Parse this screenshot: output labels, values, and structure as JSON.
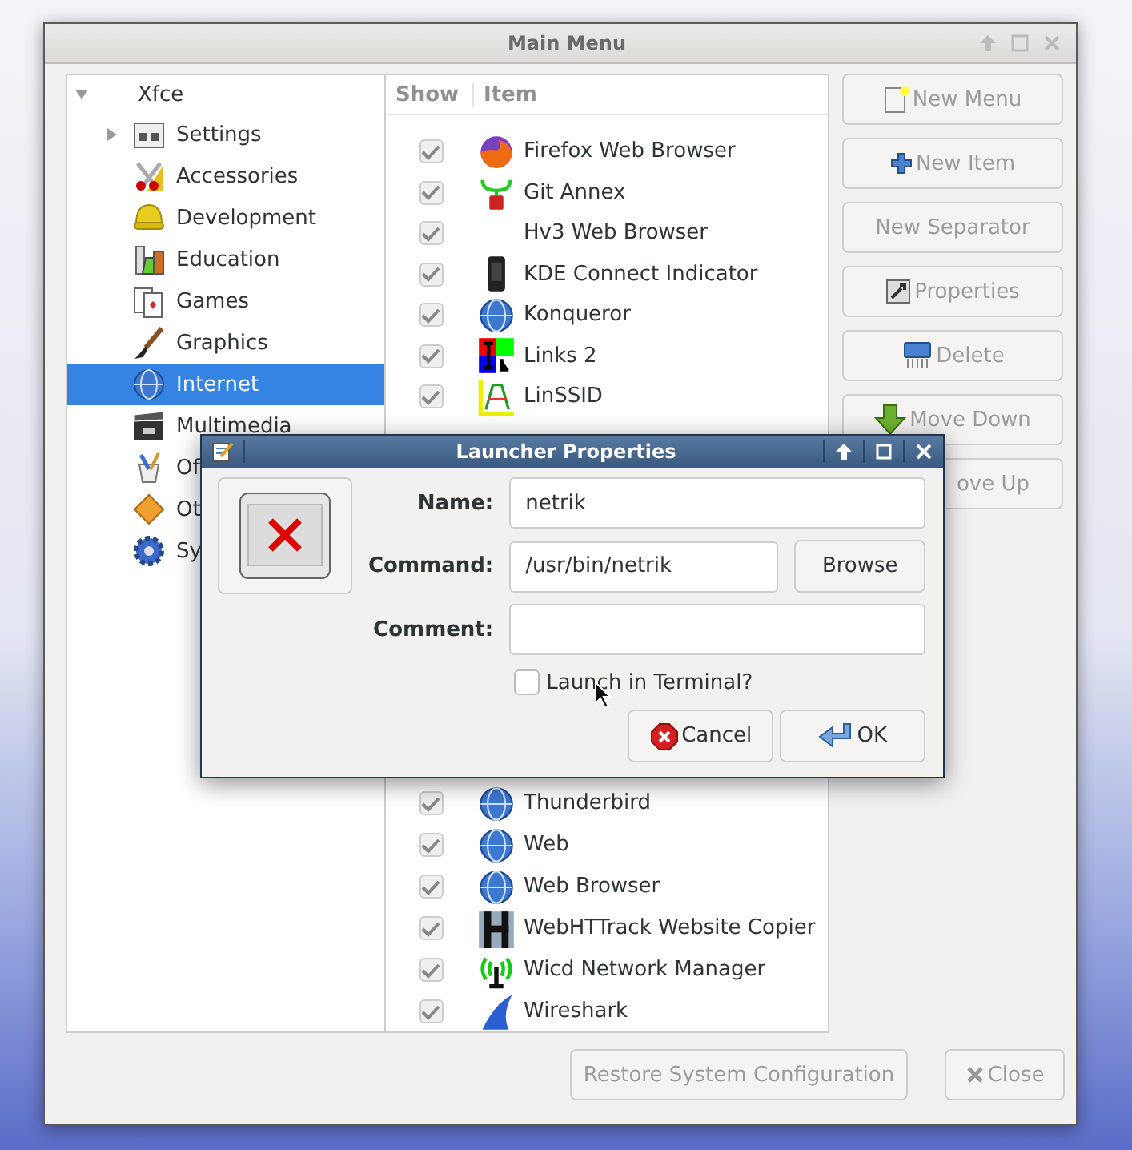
{
  "main_window": {
    "title": "Main Menu",
    "tree": {
      "label": "Xfce",
      "expanded": true,
      "children": [
        {
          "label": "Settings",
          "has_children": true,
          "selected": false
        },
        {
          "label": "Accessories",
          "has_children": false,
          "selected": false
        },
        {
          "label": "Development",
          "has_children": false,
          "selected": false
        },
        {
          "label": "Education",
          "has_children": false,
          "selected": false
        },
        {
          "label": "Games",
          "has_children": false,
          "selected": false
        },
        {
          "label": "Graphics",
          "has_children": false,
          "selected": false
        },
        {
          "label": "Internet",
          "has_children": false,
          "selected": true
        },
        {
          "label": "Multimedia",
          "has_children": false,
          "selected": false
        },
        {
          "label": "Of",
          "has_children": false,
          "selected": false
        },
        {
          "label": "Ot",
          "has_children": false,
          "selected": false
        },
        {
          "label": "Sy",
          "has_children": false,
          "selected": false
        }
      ]
    },
    "columns": [
      "Show",
      "Item"
    ],
    "items_above": [
      {
        "label": "Firefox Web Browser",
        "show": true
      },
      {
        "label": "Git Annex",
        "show": true
      },
      {
        "label": "Hv3 Web Browser",
        "show": true
      },
      {
        "label": "KDE Connect Indicator",
        "show": true
      },
      {
        "label": "Konqueror",
        "show": true
      },
      {
        "label": "Links 2",
        "show": true
      },
      {
        "label": "LinSSID",
        "show": true
      }
    ],
    "items_below": [
      {
        "label": "Thunderbird",
        "show": true
      },
      {
        "label": "Web",
        "show": true
      },
      {
        "label": "Web Browser",
        "show": true
      },
      {
        "label": "WebHTTrack Website Copier",
        "show": true
      },
      {
        "label": "Wicd Network Manager",
        "show": true
      },
      {
        "label": "Wireshark",
        "show": true
      }
    ],
    "actions": [
      {
        "label": "New Menu",
        "disabled": true,
        "clipped": false
      },
      {
        "label": "New Item",
        "disabled": true,
        "clipped": false
      },
      {
        "label": "New Separator",
        "disabled": true,
        "clipped": false
      },
      {
        "label": "Properties",
        "disabled": true,
        "clipped": false
      },
      {
        "label": "Delete",
        "disabled": true,
        "clipped": false
      },
      {
        "label": "Move Down",
        "disabled": true,
        "clipped": false
      },
      {
        "label": "ove Up",
        "disabled": true,
        "clipped": true
      }
    ],
    "footer_buttons": [
      {
        "label": "Restore System Configuration",
        "disabled": true
      },
      {
        "label": "Close",
        "disabled": true
      }
    ]
  },
  "dialog": {
    "title": "Launcher Properties",
    "fields": [
      {
        "label": "Name:",
        "value": "netrik"
      },
      {
        "label": "Command:",
        "value": "/usr/bin/netrik"
      },
      {
        "label": "Comment:"
      }
    ],
    "browse_button": "Browse",
    "terminal_checkbox": {
      "label": "Launch in Terminal?",
      "checked": false
    },
    "buttons": [
      "Cancel",
      "OK"
    ]
  }
}
